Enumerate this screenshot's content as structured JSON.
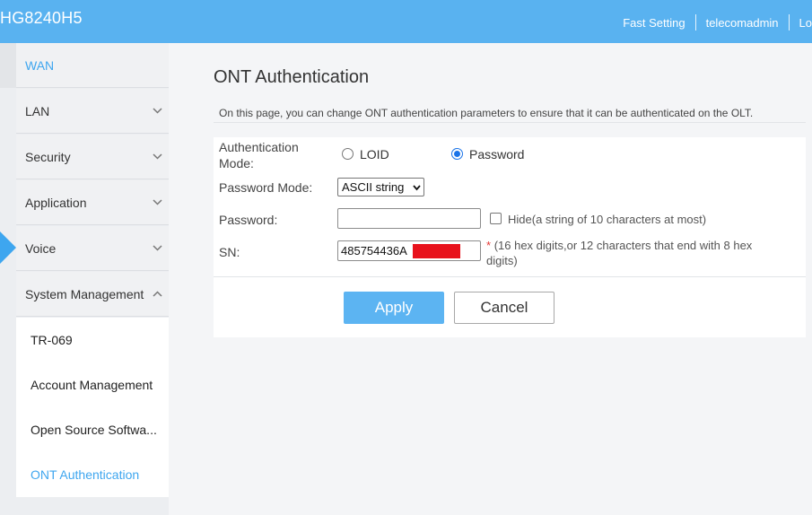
{
  "header": {
    "brand": "HG8240H5",
    "fast_setting": "Fast Setting",
    "user": "telecomadmin",
    "logout": "Lo"
  },
  "sidebar": {
    "items": [
      {
        "label": "WAN"
      },
      {
        "label": "LAN"
      },
      {
        "label": "Security"
      },
      {
        "label": "Application"
      },
      {
        "label": "Voice"
      },
      {
        "label": "System Management"
      }
    ],
    "sub_items": [
      {
        "label": "TR-069"
      },
      {
        "label": "Account Management"
      },
      {
        "label": "Open Source Softwa..."
      },
      {
        "label": "ONT Authentication"
      }
    ]
  },
  "main": {
    "title": "ONT Authentication",
    "description": "On this page, you can change ONT authentication parameters to ensure that it can be authenticated on the OLT.",
    "form": {
      "auth_mode_label_1": "Authentication",
      "auth_mode_label_2": "Mode:",
      "loid_label": "LOID",
      "password_option_label": "Password",
      "password_mode_label": "Password Mode:",
      "password_mode_value": "ASCII string",
      "password_label": "Password:",
      "password_value": "",
      "hide_hint": "Hide(a string of 10 characters at most)",
      "sn_label": "SN:",
      "sn_value": "485754436A",
      "sn_required": "*",
      "sn_hint_1": "(16 hex digits,or 12 characters that end with 8 hex",
      "sn_hint_2": "digits)"
    },
    "buttons": {
      "apply": "Apply",
      "cancel": "Cancel"
    }
  },
  "colors": {
    "header_bg": "#59b2f0",
    "accent": "#3ea6ef",
    "apply_bg": "#5cb4f2",
    "redaction": "#e8121c"
  }
}
